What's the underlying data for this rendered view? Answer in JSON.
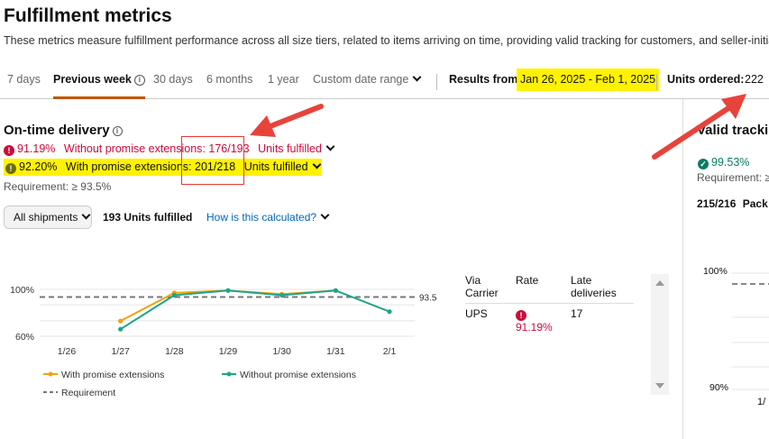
{
  "header": {
    "title": "Fulfillment metrics",
    "subtitle": "These metrics measure fulfillment performance across all size tiers, related to items arriving on time, providing valid tracking for customers, and seller-initiated ca"
  },
  "tabs": [
    {
      "label": "7 days"
    },
    {
      "label": "Previous week",
      "active": true
    },
    {
      "label": "30 days"
    },
    {
      "label": "6 months"
    },
    {
      "label": "1 year"
    },
    {
      "label": "Custom date range"
    }
  ],
  "results": {
    "label": "Results from:",
    "range": "Jan 26, 2025 - Feb 1, 2025"
  },
  "units_ordered": {
    "label": "Units ordered:",
    "value": "222"
  },
  "on_time": {
    "title": "On-time delivery",
    "without": {
      "pct": "91.19%",
      "text": "Without promise extensions:",
      "ratio": "176/193",
      "units": "Units fulfilled"
    },
    "with": {
      "pct": "92.20%",
      "text": "With promise extensions:",
      "ratio": "201/218",
      "units": "Units fulfilled"
    },
    "requirement": "Requirement: ≥ 93.5%",
    "filter_label": "All shipments",
    "units_fulfilled": "193 Units fulfilled",
    "how_link": "How is this calculated?"
  },
  "carrier_table": {
    "headers": [
      "Via Carrier",
      "Rate",
      "Late deliveries"
    ],
    "rows": [
      {
        "carrier": "UPS",
        "rate": "91.19%",
        "late": "17"
      }
    ]
  },
  "valid_tracking": {
    "title": "Valid tracki",
    "pct": "99.53%",
    "requirement": "Requirement: ≥",
    "ratio": "215/216",
    "ratio_text": "Pack",
    "y_labels": [
      "100%",
      "90%"
    ],
    "x_label": "1/"
  },
  "colors": {
    "accent": "#c45500",
    "with": "#f0a30a",
    "without": "#1ca58a",
    "alert": "#cc0c39",
    "highlight": "#fff200",
    "arrow": "#e8433b"
  },
  "chart_data": {
    "type": "line",
    "categories": [
      "1/26",
      "1/27",
      "1/28",
      "1/29",
      "1/30",
      "1/31",
      "2/1"
    ],
    "series": [
      {
        "name": "With promise extensions",
        "values": [
          null,
          73,
          97,
          99,
          96,
          99,
          null
        ]
      },
      {
        "name": "Without promise extensions",
        "values": [
          null,
          66,
          95,
          99,
          95,
          99,
          81
        ]
      }
    ],
    "requirement": {
      "name": "Requirement",
      "value": 93.5,
      "label": "93.5"
    },
    "y_ticks": [
      {
        "value": 100,
        "label": "100%"
      },
      {
        "value": 60,
        "label": "60%"
      }
    ],
    "ylim": [
      55,
      104
    ],
    "grid": true,
    "legend": "bottom"
  }
}
